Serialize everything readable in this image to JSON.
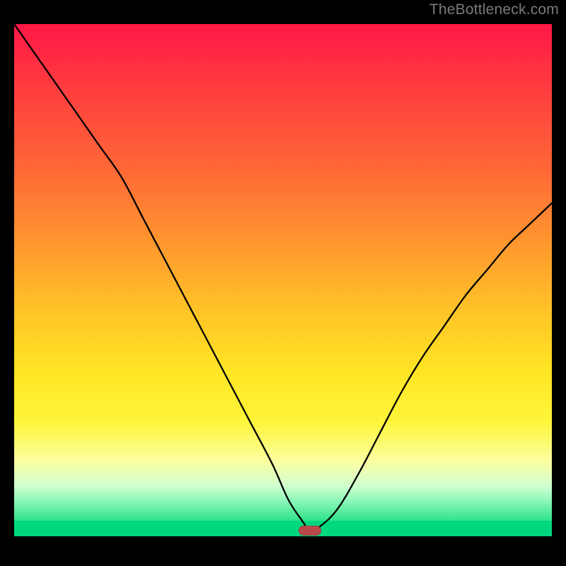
{
  "watermark": {
    "text": "TheBottleneck.com"
  },
  "chart_data": {
    "type": "line",
    "title": "",
    "xlabel": "",
    "ylabel": "",
    "xlim": [
      0,
      100
    ],
    "ylim": [
      0,
      100
    ],
    "x": [
      0,
      4,
      8,
      12,
      16,
      20,
      24,
      28,
      32,
      36,
      40,
      44,
      48,
      51,
      53.5,
      55,
      56.5,
      60,
      64,
      68,
      72,
      76,
      80,
      84,
      88,
      92,
      96,
      100
    ],
    "values": [
      100,
      94,
      88,
      82,
      76,
      70,
      62,
      54,
      46,
      38,
      30,
      22,
      14,
      7,
      3,
      1,
      1.5,
      5,
      12,
      20,
      28,
      35,
      41,
      47,
      52,
      57,
      61,
      65
    ],
    "series": [
      {
        "name": "bottleneck-curve",
        "x_ref": "x",
        "y_ref": "values"
      }
    ],
    "marker": {
      "x": 55,
      "y": 1
    },
    "background": {
      "type": "vertical-gradient",
      "stops": [
        {
          "pos": 0,
          "color": "#ff1846"
        },
        {
          "pos": 50,
          "color": "#ffb92b"
        },
        {
          "pos": 80,
          "color": "#fff53a"
        },
        {
          "pos": 100,
          "color": "#00d880"
        }
      ]
    },
    "grid": false,
    "legend": false
  }
}
